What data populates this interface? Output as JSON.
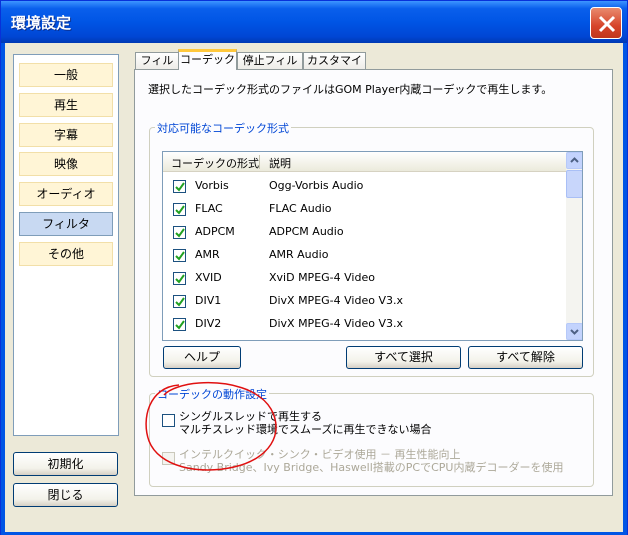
{
  "window": {
    "title": "環境設定"
  },
  "nav": {
    "items": [
      {
        "label": "一般"
      },
      {
        "label": "再生"
      },
      {
        "label": "字幕"
      },
      {
        "label": "映像"
      },
      {
        "label": "オーディオ"
      },
      {
        "label": "フィルタ",
        "selected": true
      },
      {
        "label": "その他"
      }
    ],
    "reset_label": "初期化",
    "close_label": "閉じる"
  },
  "tabs": [
    {
      "label": "フィルタ"
    },
    {
      "label": "コーデック",
      "active": true
    },
    {
      "label": "停止フィルタ"
    },
    {
      "label": "カスタマイズ"
    }
  ],
  "codec_page": {
    "description": "選択したコーデック形式のファイルはGOM Player内蔵コーデックで再生します。",
    "formats_group_label": "対応可能なコーデック形式",
    "columns": [
      "コーデックの形式",
      "説明"
    ],
    "rows": [
      {
        "format": "Vorbis",
        "desc": "Ogg-Vorbis Audio",
        "checked": true
      },
      {
        "format": "FLAC",
        "desc": "FLAC Audio",
        "checked": true
      },
      {
        "format": "ADPCM",
        "desc": "ADPCM Audio",
        "checked": true
      },
      {
        "format": "AMR",
        "desc": "AMR Audio",
        "checked": true
      },
      {
        "format": "XVID",
        "desc": "XviD MPEG-4 Video",
        "checked": true
      },
      {
        "format": "DIV1",
        "desc": "DivX MPEG-4 Video V3.x",
        "checked": true
      },
      {
        "format": "DIV2",
        "desc": "DivX MPEG-4 Video V3.x",
        "checked": true
      }
    ],
    "help_label": "ヘルプ",
    "select_all_label": "すべて選択",
    "deselect_all_label": "すべて解除",
    "behavior_group_label": "コーデックの動作設定",
    "single_thread": {
      "line1": "シングルスレッドで再生する",
      "line2": "マルチスレッド環境でスムーズに再生できない場合",
      "checked": false
    },
    "quick_sync": {
      "line1": "インテルクイック・シンク・ビデオ使用 － 再生性能向上",
      "line2": "Sandy Bridge、Ivy Bridge、Haswell搭載のPCでCPU内蔵デコーダーを使用",
      "checked": false,
      "disabled": true
    }
  },
  "colors": {
    "titlebar": "#0055E5",
    "group_label": "#0046D5",
    "check_mark": "#21A121",
    "annotation": "#E01010"
  }
}
